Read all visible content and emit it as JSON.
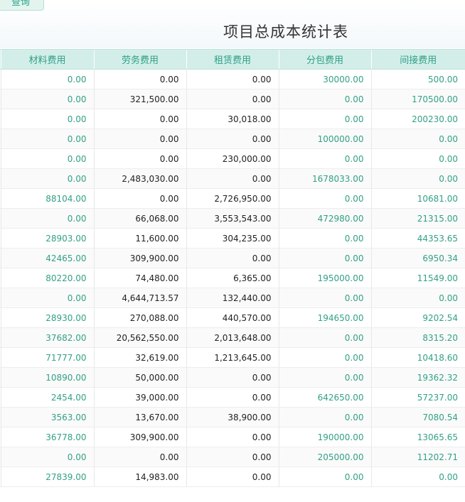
{
  "toolbar": {
    "query_label": "查询"
  },
  "report": {
    "title": "项目总成本统计表"
  },
  "table": {
    "headers": [
      "材料费用",
      "劳务费用",
      "租赁费用",
      "分包费用",
      "间接费用"
    ],
    "rows": [
      [
        "0.00",
        "0.00",
        "0.00",
        "30000.00",
        "500.00"
      ],
      [
        "0.00",
        "321,500.00",
        "0.00",
        "0.00",
        "170500.00"
      ],
      [
        "0.00",
        "0.00",
        "30,018.00",
        "0.00",
        "200230.00"
      ],
      [
        "0.00",
        "0.00",
        "0.00",
        "100000.00",
        "0.00"
      ],
      [
        "0.00",
        "0.00",
        "230,000.00",
        "0.00",
        "0.00"
      ],
      [
        "0.00",
        "2,483,030.00",
        "0.00",
        "1678033.00",
        "0.00"
      ],
      [
        "88104.00",
        "0.00",
        "2,726,950.00",
        "0.00",
        "10681.00"
      ],
      [
        "0.00",
        "66,068.00",
        "3,553,543.00",
        "472980.00",
        "21315.00"
      ],
      [
        "28903.00",
        "11,600.00",
        "304,235.00",
        "0.00",
        "44353.65"
      ],
      [
        "42465.00",
        "309,900.00",
        "0.00",
        "0.00",
        "6950.34"
      ],
      [
        "80220.00",
        "74,480.00",
        "6,365.00",
        "195000.00",
        "11549.00"
      ],
      [
        "0.00",
        "4,644,713.57",
        "132,440.00",
        "0.00",
        "0.00"
      ],
      [
        "28930.00",
        "270,088.00",
        "440,570.00",
        "194650.00",
        "9202.54"
      ],
      [
        "37682.00",
        "20,562,550.00",
        "2,013,648.00",
        "0.00",
        "8315.20"
      ],
      [
        "71777.00",
        "32,619.00",
        "1,213,645.00",
        "0.00",
        "10418.60"
      ],
      [
        "10890.00",
        "50,000.00",
        "0.00",
        "0.00",
        "19362.32"
      ],
      [
        "2454.00",
        "39,000.00",
        "0.00",
        "642650.00",
        "57237.00"
      ],
      [
        "3563.00",
        "13,670.00",
        "38,900.00",
        "0.00",
        "7080.54"
      ],
      [
        "36778.00",
        "309,900.00",
        "0.00",
        "190000.00",
        "13065.65"
      ],
      [
        "0.00",
        "0.00",
        "0.00",
        "205000.00",
        "11202.71"
      ],
      [
        "27839.00",
        "14,983.00",
        "0.00",
        "0.00",
        "0.00"
      ]
    ]
  },
  "colors": {
    "accent": "#33a085",
    "header_background": "#d3eee9",
    "text": "#222222"
  }
}
